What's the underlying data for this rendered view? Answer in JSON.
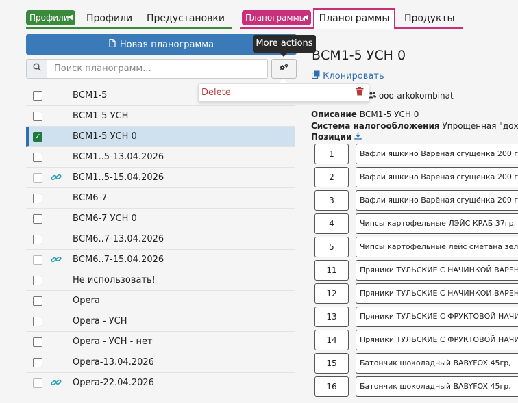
{
  "topnav": {
    "badge_profiles": "Профили",
    "tab_profiles": "Профили",
    "tab_presets": "Предустановки",
    "badge_planograms": "Планограммы",
    "tab_planograms": "Планограммы",
    "tab_products": "Продукты"
  },
  "left": {
    "new_button": "Новая планограмма",
    "search_placeholder": "Поиск планограмм...",
    "tooltip": "More actions",
    "menu_delete": "Delete",
    "rows": [
      {
        "label": "ВСМ1-5",
        "checked": false,
        "linked": false
      },
      {
        "label": "ВСМ1-5 УСН",
        "checked": false,
        "linked": false
      },
      {
        "label": "ВСМ1-5 УСН 0",
        "checked": true,
        "linked": false
      },
      {
        "label": "ВСМ1..5-13.04.2026",
        "checked": false,
        "linked": false
      },
      {
        "label": "ВСМ1..5-15.04.2026",
        "checked": false,
        "linked": true
      },
      {
        "label": "ВСМ6-7",
        "checked": false,
        "linked": false
      },
      {
        "label": "ВСМ6-7 УСН 0",
        "checked": false,
        "linked": false
      },
      {
        "label": "ВСМ6..7-13.04.2026",
        "checked": false,
        "linked": false
      },
      {
        "label": "ВСМ6..7-15.04.2026",
        "checked": false,
        "linked": true
      },
      {
        "label": "Не использовать!",
        "checked": false,
        "linked": false
      },
      {
        "label": "Opera",
        "checked": false,
        "linked": false
      },
      {
        "label": "Opera - УСН",
        "checked": false,
        "linked": false
      },
      {
        "label": "Opera - УСН - нет",
        "checked": false,
        "linked": false
      },
      {
        "label": "Opera-13.04.2026",
        "checked": false,
        "linked": false
      },
      {
        "label": "Opera-22.04.2026",
        "checked": false,
        "linked": true
      }
    ]
  },
  "detail": {
    "title": "ВСМ1-5 УСН 0",
    "clone_label": "Клонировать",
    "owner": "ooo-arkokombinat",
    "description_label": "Описание",
    "description_value": "ВСМ1-5 УСН 0",
    "tax_label": "Система налогообложения",
    "tax_value": "Упрощенная \"доход м",
    "positions_label": "Позиции",
    "positions": [
      {
        "num": "1",
        "name": "Вафли яшкино Варёная сгущёнка 200 г"
      },
      {
        "num": "2",
        "name": "Вафли яшкино Варёная сгущёнка 200 г"
      },
      {
        "num": "3",
        "name": "Вафли яшкино Варёная сгущёнка 200 г"
      },
      {
        "num": "4",
        "name": "Чипсы картофельные ЛЭЙС КРАБ 37гр,"
      },
      {
        "num": "5",
        "name": "Чипсы картофельные лейс сметана зел"
      },
      {
        "num": "11",
        "name": "Пряники ТУЛЬСКИЕ С НАЧИНКОЙ ВАРЕН"
      },
      {
        "num": "12",
        "name": "Пряники ТУЛЬСКИЕ С НАЧИНКОЙ ВАРЕН"
      },
      {
        "num": "13",
        "name": "Пряники ТУЛЬСКИЕ С ФРУКТОВОЙ НАЧИ"
      },
      {
        "num": "14",
        "name": "Пряники ТУЛЬСКИЕ С ФРУКТОВОЙ НАЧИ"
      },
      {
        "num": "15",
        "name": "Батончик шоколадный BABYFOX 45гр,"
      },
      {
        "num": "16",
        "name": "Батончик шоколадный BABYFOX 45гр,"
      }
    ]
  },
  "colors": {
    "green": "#3a8a3c",
    "pink": "#c8307a",
    "primary": "#3a7ab8",
    "link": "#2f6fae",
    "danger": "#b53a3a",
    "selected_row": "#cfe1ef"
  }
}
